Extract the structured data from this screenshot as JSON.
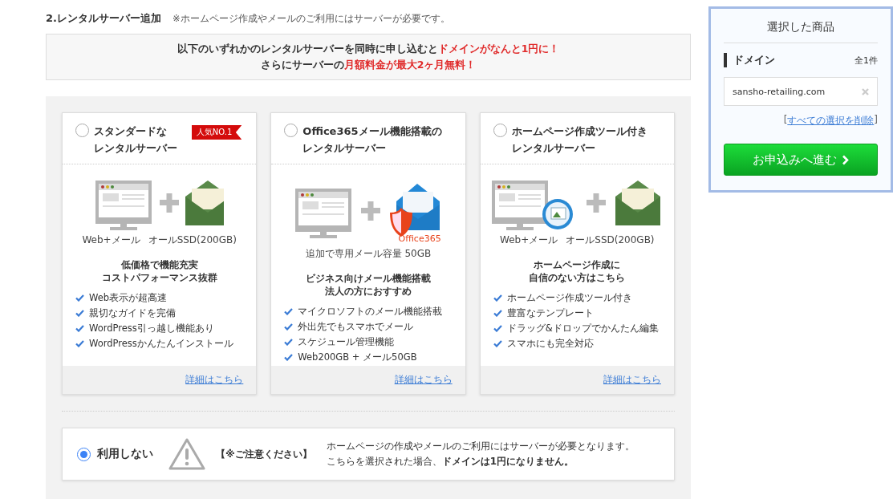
{
  "section": {
    "title": "2.レンタルサーバー追加",
    "note": "※ホームページ作成やメールのご利用にはサーバーが必要です。"
  },
  "banner": {
    "lines": [
      [
        {
          "text": "以下のいずれかのレンタルサーバーを同時に申し込むと",
          "highlight": false
        },
        {
          "text": "ドメインがなんと1円に！",
          "highlight": true
        }
      ],
      [
        {
          "text": "さらにサーバーの",
          "highlight": false
        },
        {
          "text": "月額料金が最大2ヶ月無料！",
          "highlight": true
        }
      ]
    ]
  },
  "plans": [
    {
      "kind": "standard",
      "title": [
        "スタンダードな",
        "レンタルサーバー"
      ],
      "selected": false,
      "badge": "人気NO.1",
      "specs": [
        "Web+メール",
        "オールSSD(200GB)"
      ],
      "headline": [
        "低価格で機能充実",
        "コストパフォーマンス抜群"
      ],
      "features": [
        "Web表示が超高速",
        "親切なガイドを完備",
        "WordPress引っ越し機能あり",
        "WordPressかんたんインストール"
      ],
      "link": "詳細はこちら"
    },
    {
      "kind": "office365",
      "title": [
        "Office365メール機能搭載の",
        "レンタルサーバー"
      ],
      "selected": false,
      "illustration_label": "Office365",
      "specs": [
        "追加で専用メール容量 50GB"
      ],
      "headline": [
        "ビジネス向けメール機能搭載",
        "法人の方におすすめ"
      ],
      "features": [
        "マイクロソフトのメール機能搭載",
        "外出先でもスマホでメール",
        "スケジュール管理機能",
        "Web200GB + メール50GB"
      ],
      "link": "詳細はこちら"
    },
    {
      "kind": "builder",
      "title": [
        "ホームページ作成ツール付き",
        "レンタルサーバー"
      ],
      "selected": false,
      "specs": [
        "Web+メール",
        "オールSSD(200GB)"
      ],
      "headline": [
        "ホームページ作成に",
        "自信のない方はこちら"
      ],
      "features": [
        "ホームページ作成ツール付き",
        "豊富なテンプレート",
        "ドラッグ&ドロップでかんたん編集",
        "スマホにも完全対応"
      ],
      "link": "詳細はこちら"
    }
  ],
  "no_server": {
    "label": "利用しない",
    "selected": true,
    "caution": "【※ご注意ください】",
    "message": [
      "ホームページの作成やメールのご利用にはサーバーが必要となります。",
      "こちらを選択された場合、**ドメインは1円になりません。**"
    ]
  },
  "cart": {
    "title": "選択した商品",
    "category": "ドメイン",
    "count": "全1件",
    "items": [
      "sansho-retailing.com"
    ],
    "clear_open": "[",
    "clear_link": "すべての選択を削除",
    "clear_close": "]",
    "proceed_button": "お申込みへ進む"
  }
}
